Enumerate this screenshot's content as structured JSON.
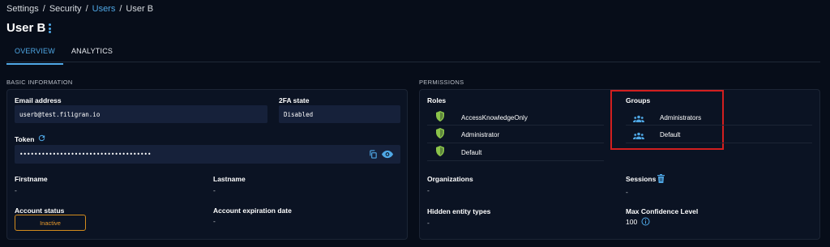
{
  "breadcrumb": [
    "Settings",
    "Security",
    "Users",
    "User B"
  ],
  "breadcrumb_sep": "/",
  "page": {
    "title": "User B"
  },
  "tabs": [
    {
      "label": "OVERVIEW",
      "active": true
    },
    {
      "label": "ANALYTICS",
      "active": false
    }
  ],
  "basic": {
    "section_label": "BASIC INFORMATION",
    "email": {
      "label": "Email address",
      "value": "userb@test.filigran.io"
    },
    "twofa": {
      "label": "2FA state",
      "value": "Disabled"
    },
    "token": {
      "label": "Token",
      "value": "••••••••••••••••••••••••••••••••••••"
    },
    "firstname": {
      "label": "Firstname",
      "value": "-"
    },
    "lastname": {
      "label": "Lastname",
      "value": "-"
    },
    "account_status": {
      "label": "Account status",
      "value": "Inactive"
    },
    "expiration": {
      "label": "Account expiration date",
      "value": "-"
    }
  },
  "permissions": {
    "section_label": "PERMISSIONS",
    "roles": {
      "label": "Roles",
      "items": [
        "AccessKnowledgeOnly",
        "Administrator",
        "Default"
      ]
    },
    "groups": {
      "label": "Groups",
      "items": [
        "Administrators",
        "Default"
      ]
    },
    "organizations": {
      "label": "Organizations",
      "value": "-"
    },
    "sessions": {
      "label": "Sessions",
      "value": "-"
    },
    "hidden_types": {
      "label": "Hidden entity types",
      "value": "-"
    },
    "max_confidence": {
      "label": "Max Confidence Level",
      "value": "100"
    }
  },
  "colors": {
    "accent": "#4fa8e6",
    "role_icon": "#8bc34a",
    "group_icon": "#4fa8e6",
    "inactive": "#e89a2b",
    "highlight_box": "#d21f1f"
  },
  "icons": {
    "role": "shield-icon",
    "group": "group-icon",
    "token_refresh": "refresh-icon",
    "copy": "copy-icon",
    "reveal": "eye-icon",
    "sessions_delete": "trash-icon",
    "confidence_info": "info-icon",
    "title_menu": "more-vertical-icon"
  }
}
